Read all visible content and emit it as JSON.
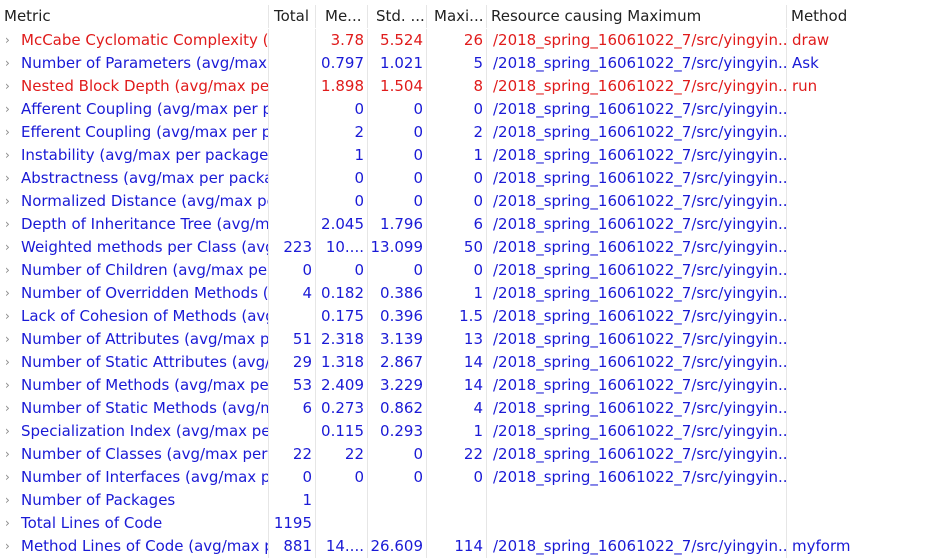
{
  "header": {
    "metric": "Metric",
    "total": "Total",
    "mean": "Me...",
    "std_dev": "Std. ...",
    "maximum": "Maxi...",
    "resource": "Resource causing Maximum",
    "method": "Method"
  },
  "rows": [
    {
      "metric": "McCabe Cyclomatic Complexity (a",
      "total": "",
      "mean": "3.78",
      "std": "5.524",
      "max": "26",
      "resource": "/2018_spring_16061022_7/src/yingyin...",
      "method": "draw",
      "warn": true
    },
    {
      "metric": "Number of Parameters (avg/max p",
      "total": "",
      "mean": "0.797",
      "std": "1.021",
      "max": "5",
      "resource": "/2018_spring_16061022_7/src/yingyin...",
      "method": "Ask",
      "warn": false
    },
    {
      "metric": "Nested Block Depth (avg/max per",
      "total": "",
      "mean": "1.898",
      "std": "1.504",
      "max": "8",
      "resource": "/2018_spring_16061022_7/src/yingyin...",
      "method": "run",
      "warn": true
    },
    {
      "metric": "Afferent Coupling (avg/max per p",
      "total": "",
      "mean": "0",
      "std": "0",
      "max": "0",
      "resource": "/2018_spring_16061022_7/src/yingyin...",
      "method": "",
      "warn": false
    },
    {
      "metric": "Efferent Coupling (avg/max per pa",
      "total": "",
      "mean": "2",
      "std": "0",
      "max": "2",
      "resource": "/2018_spring_16061022_7/src/yingyin...",
      "method": "",
      "warn": false
    },
    {
      "metric": "Instability (avg/max per packageFi",
      "total": "",
      "mean": "1",
      "std": "0",
      "max": "1",
      "resource": "/2018_spring_16061022_7/src/yingyin...",
      "method": "",
      "warn": false
    },
    {
      "metric": "Abstractness (avg/max per packag",
      "total": "",
      "mean": "0",
      "std": "0",
      "max": "0",
      "resource": "/2018_spring_16061022_7/src/yingyin...",
      "method": "",
      "warn": false
    },
    {
      "metric": "Normalized Distance (avg/max pe",
      "total": "",
      "mean": "0",
      "std": "0",
      "max": "0",
      "resource": "/2018_spring_16061022_7/src/yingyin...",
      "method": "",
      "warn": false
    },
    {
      "metric": "Depth of Inheritance Tree (avg/ma",
      "total": "",
      "mean": "2.045",
      "std": "1.796",
      "max": "6",
      "resource": "/2018_spring_16061022_7/src/yingyin...",
      "method": "",
      "warn": false
    },
    {
      "metric": "Weighted methods per Class (avg",
      "total": "223",
      "mean": "10....",
      "std": "13.099",
      "max": "50",
      "resource": "/2018_spring_16061022_7/src/yingyin...",
      "method": "",
      "warn": false
    },
    {
      "metric": "Number of Children (avg/max per",
      "total": "0",
      "mean": "0",
      "std": "0",
      "max": "0",
      "resource": "/2018_spring_16061022_7/src/yingyin...",
      "method": "",
      "warn": false
    },
    {
      "metric": "Number of Overridden Methods (",
      "total": "4",
      "mean": "0.182",
      "std": "0.386",
      "max": "1",
      "resource": "/2018_spring_16061022_7/src/yingyin...",
      "method": "",
      "warn": false
    },
    {
      "metric": "Lack of Cohesion of Methods (avg",
      "total": "",
      "mean": "0.175",
      "std": "0.396",
      "max": "1.5",
      "resource": "/2018_spring_16061022_7/src/yingyin...",
      "method": "",
      "warn": false
    },
    {
      "metric": "Number of Attributes (avg/max pe",
      "total": "51",
      "mean": "2.318",
      "std": "3.139",
      "max": "13",
      "resource": "/2018_spring_16061022_7/src/yingyin...",
      "method": "",
      "warn": false
    },
    {
      "metric": "Number of Static Attributes (avg/r",
      "total": "29",
      "mean": "1.318",
      "std": "2.867",
      "max": "14",
      "resource": "/2018_spring_16061022_7/src/yingyin...",
      "method": "",
      "warn": false
    },
    {
      "metric": "Number of Methods (avg/max per",
      "total": "53",
      "mean": "2.409",
      "std": "3.229",
      "max": "14",
      "resource": "/2018_spring_16061022_7/src/yingyin...",
      "method": "",
      "warn": false
    },
    {
      "metric": "Number of Static Methods (avg/m",
      "total": "6",
      "mean": "0.273",
      "std": "0.862",
      "max": "4",
      "resource": "/2018_spring_16061022_7/src/yingyin...",
      "method": "",
      "warn": false
    },
    {
      "metric": "Specialization Index (avg/max per",
      "total": "",
      "mean": "0.115",
      "std": "0.293",
      "max": "1",
      "resource": "/2018_spring_16061022_7/src/yingyin...",
      "method": "",
      "warn": false
    },
    {
      "metric": "Number of Classes (avg/max per p",
      "total": "22",
      "mean": "22",
      "std": "0",
      "max": "22",
      "resource": "/2018_spring_16061022_7/src/yingyin...",
      "method": "",
      "warn": false
    },
    {
      "metric": "Number of Interfaces (avg/max pe",
      "total": "0",
      "mean": "0",
      "std": "0",
      "max": "0",
      "resource": "/2018_spring_16061022_7/src/yingyin...",
      "method": "",
      "warn": false
    },
    {
      "metric": "Number of Packages",
      "total": "1",
      "mean": "",
      "std": "",
      "max": "",
      "resource": "",
      "method": "",
      "warn": false
    },
    {
      "metric": "Total Lines of Code",
      "total": "1195",
      "mean": "",
      "std": "",
      "max": "",
      "resource": "",
      "method": "",
      "warn": false
    },
    {
      "metric": "Method Lines of Code (avg/max p",
      "total": "881",
      "mean": "14....",
      "std": "26.609",
      "max": "114",
      "resource": "/2018_spring_16061022_7/src/yingyin...",
      "method": "myform",
      "warn": false
    }
  ],
  "icons": {
    "row_expander": "chevron-right-icon"
  },
  "colors": {
    "normal_text": "#1a1ad6",
    "warning_text": "#e01b1b",
    "expander": "#8a8a8a"
  }
}
